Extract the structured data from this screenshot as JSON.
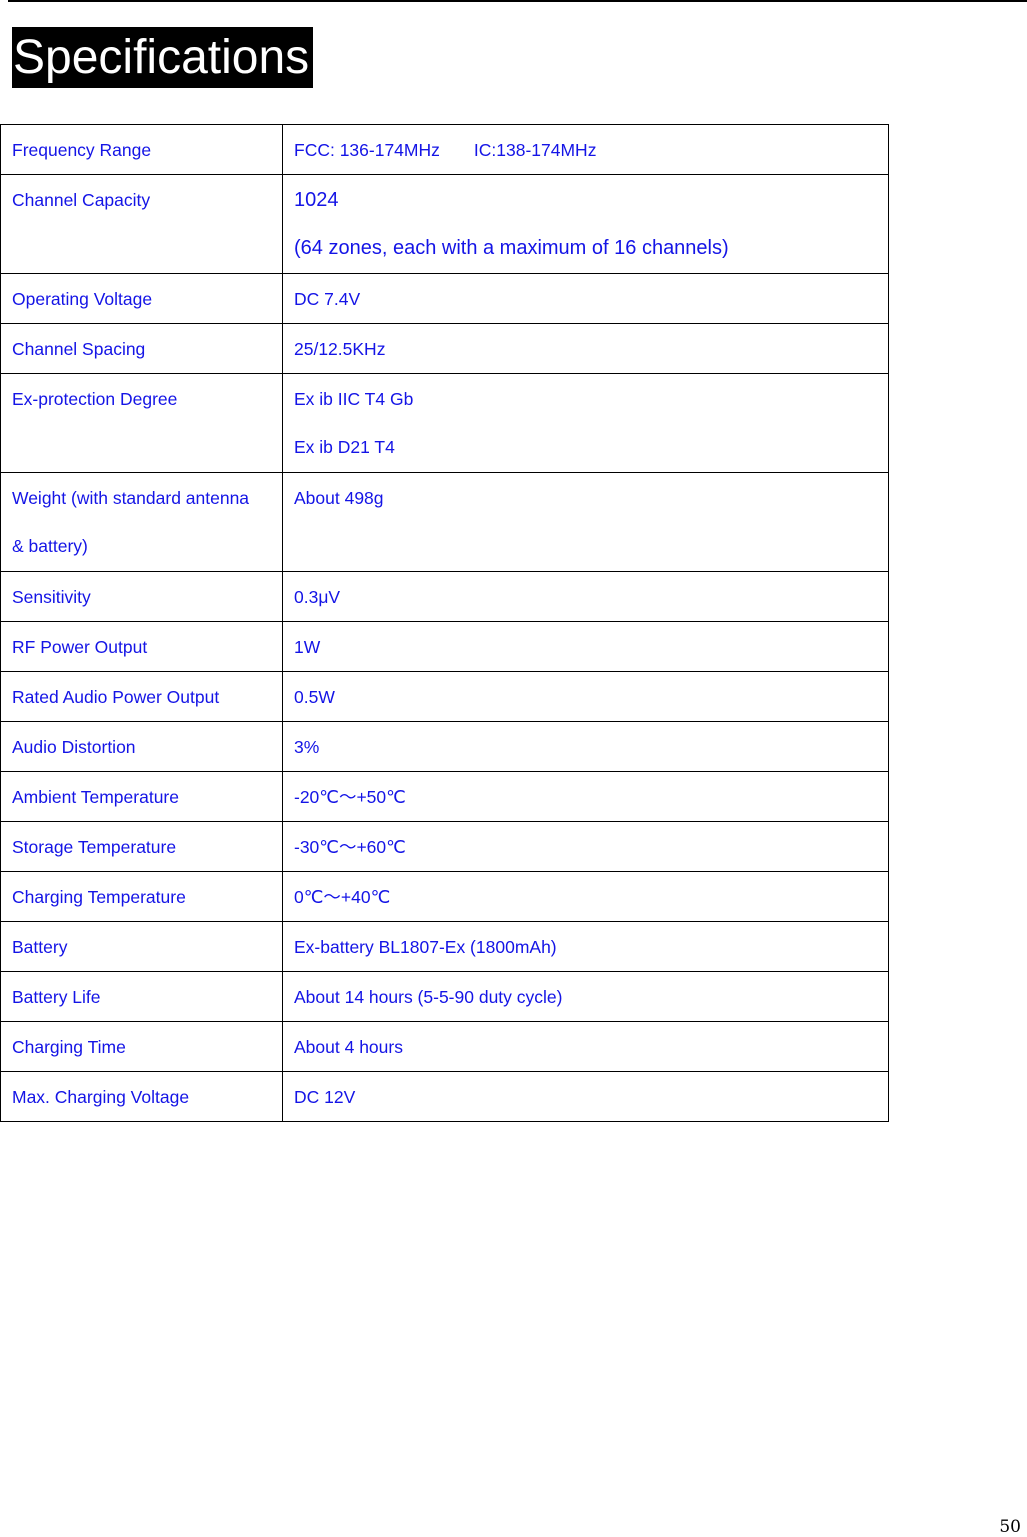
{
  "page": {
    "title": "Specifications",
    "page_number": "50"
  },
  "specs": [
    {
      "label": "Frequency Range",
      "value": "FCC: 136-174MHz",
      "value_extra": "IC:138-174MHz"
    },
    {
      "label": "Channel Capacity",
      "value": "1024",
      "value_line2": "(64 zones, each with a maximum of 16 channels)"
    },
    {
      "label": "Operating Voltage",
      "value": "DC 7.4V"
    },
    {
      "label": "Channel Spacing",
      "value": "25/12.5KHz"
    },
    {
      "label": "Ex-protection Degree",
      "value": "Ex ib IIC T4 Gb",
      "value_line2": "Ex ib D21 T4"
    },
    {
      "label": "Weight (with standard antenna",
      "label_line2": "& battery)",
      "value": "About 498g"
    },
    {
      "label": "Sensitivity",
      "value": "0.3μV"
    },
    {
      "label": "RF Power Output",
      "value": "1W"
    },
    {
      "label": "Rated Audio Power Output",
      "value": "0.5W"
    },
    {
      "label": "Audio Distortion",
      "value": "3%"
    },
    {
      "label": "Ambient Temperature",
      "value": "-20℃～+50℃"
    },
    {
      "label": "Storage Temperature",
      "value": "-30℃～+60℃"
    },
    {
      "label": "Charging Temperature",
      "value": "0℃～+40℃"
    },
    {
      "label": "Battery",
      "value": "Ex-battery BL1807-Ex (1800mAh)"
    },
    {
      "label": "Battery Life",
      "value": "About 14 hours (5-5-90 duty cycle)"
    },
    {
      "label": "Charging Time",
      "value": "About 4 hours"
    },
    {
      "label": "Max. Charging Voltage",
      "value": "DC 12V"
    }
  ],
  "colors": {
    "text_blue": "#1414e6",
    "title_bg": "#000000",
    "title_fg": "#ffffff"
  }
}
